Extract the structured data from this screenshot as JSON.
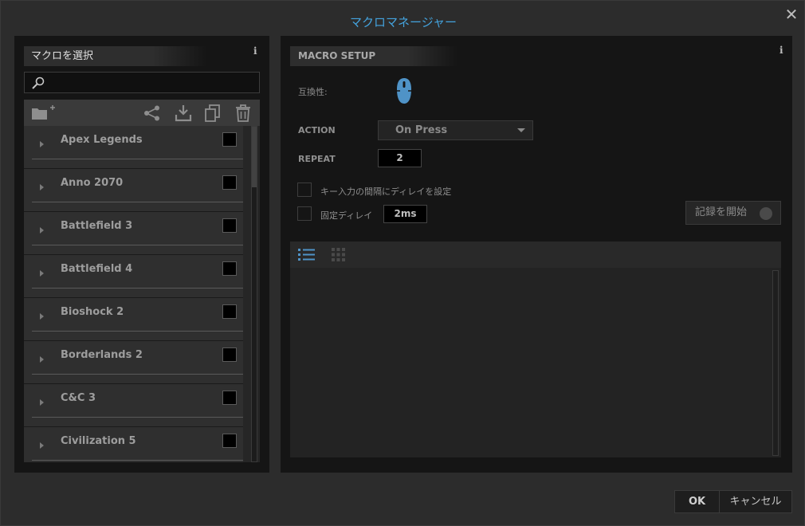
{
  "window": {
    "title": "マクロマネージャー",
    "close_glyph": "✕"
  },
  "left": {
    "header": "マクロを選択",
    "info_glyph": "i",
    "search": {
      "value": "",
      "placeholder": ""
    },
    "toolbar_icons": [
      "new-folder-icon",
      "share-icon",
      "download-icon",
      "copy-icon",
      "trash-icon"
    ],
    "items": [
      {
        "label": "Apex Legends",
        "checked": false
      },
      {
        "label": "Anno 2070",
        "checked": false
      },
      {
        "label": "Battlefield 3",
        "checked": false
      },
      {
        "label": "Battlefield 4",
        "checked": false
      },
      {
        "label": "Bioshock 2",
        "checked": false
      },
      {
        "label": "Borderlands 2",
        "checked": false
      },
      {
        "label": "C&C 3",
        "checked": false
      },
      {
        "label": "Civilization 5",
        "checked": false
      }
    ]
  },
  "right": {
    "header": "MACRO SETUP",
    "info_glyph": "i",
    "compat_label": "互換性:",
    "action": {
      "label": "ACTION",
      "value": "On Press"
    },
    "repeat": {
      "label": "REPEAT",
      "value": "2"
    },
    "delay_between_label": "キー入力の間隔にディレイを設定",
    "fixed_delay": {
      "label": "固定ディレイ",
      "value": "2ms"
    },
    "record_label": "記録を開始",
    "accent_color": "#4f93c7"
  },
  "footer": {
    "ok_label": "OK",
    "cancel_label": "キャンセル"
  }
}
